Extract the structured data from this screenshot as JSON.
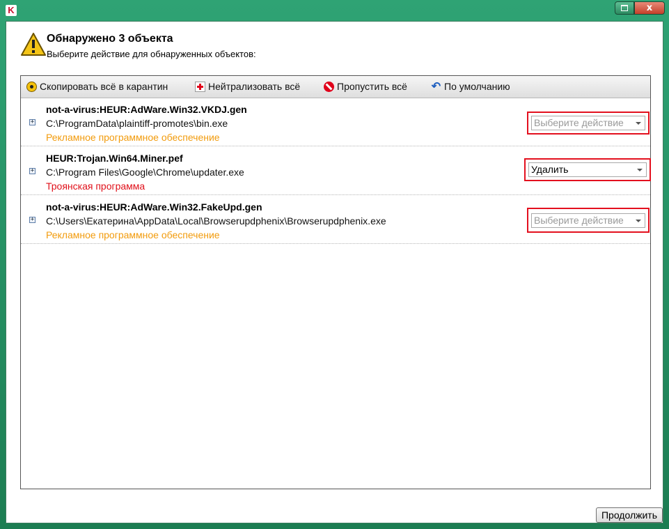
{
  "window": {
    "logo_letter": "K",
    "maximize_label": "",
    "close_label": "x"
  },
  "header": {
    "title": "Обнаружено 3 объекта",
    "subtitle": "Выберите действие для обнаруженных объектов:",
    "icon": "warning-triangle-icon"
  },
  "toolbar": {
    "quarantine_all": "Скопировать всё в карантин",
    "neutralize_all": "Нейтрализовать всё",
    "skip_all": "Пропустить всё",
    "default": "По умолчанию"
  },
  "threats": [
    {
      "name": "not-a-virus:HEUR:AdWare.Win32.VKDJ.gen",
      "path": "C:\\ProgramData\\plaintiff-promotes\\bin.exe",
      "type": "Рекламное программное обеспечение",
      "action": "Выберите действие"
    },
    {
      "name": "HEUR:Trojan.Win64.Miner.pef",
      "path": "C:\\Program Files\\Google\\Chrome\\updater.exe",
      "type": "Троянская программа",
      "action": "Удалить"
    },
    {
      "name": "not-a-virus:HEUR:AdWare.Win32.FakeUpd.gen",
      "path": "C:\\Users\\Екатерина\\AppData\\Local\\Browserupdphenix\\Browserupdphenix.exe",
      "type": "Рекламное программное обеспечение",
      "action": "Выберите действие"
    }
  ],
  "footer": {
    "continue_label": "Продолжить"
  },
  "colors": {
    "adware": "#f29b0c",
    "trojan": "#e0101a",
    "highlight_box": "#e3101e",
    "frame": "#2fa374"
  }
}
